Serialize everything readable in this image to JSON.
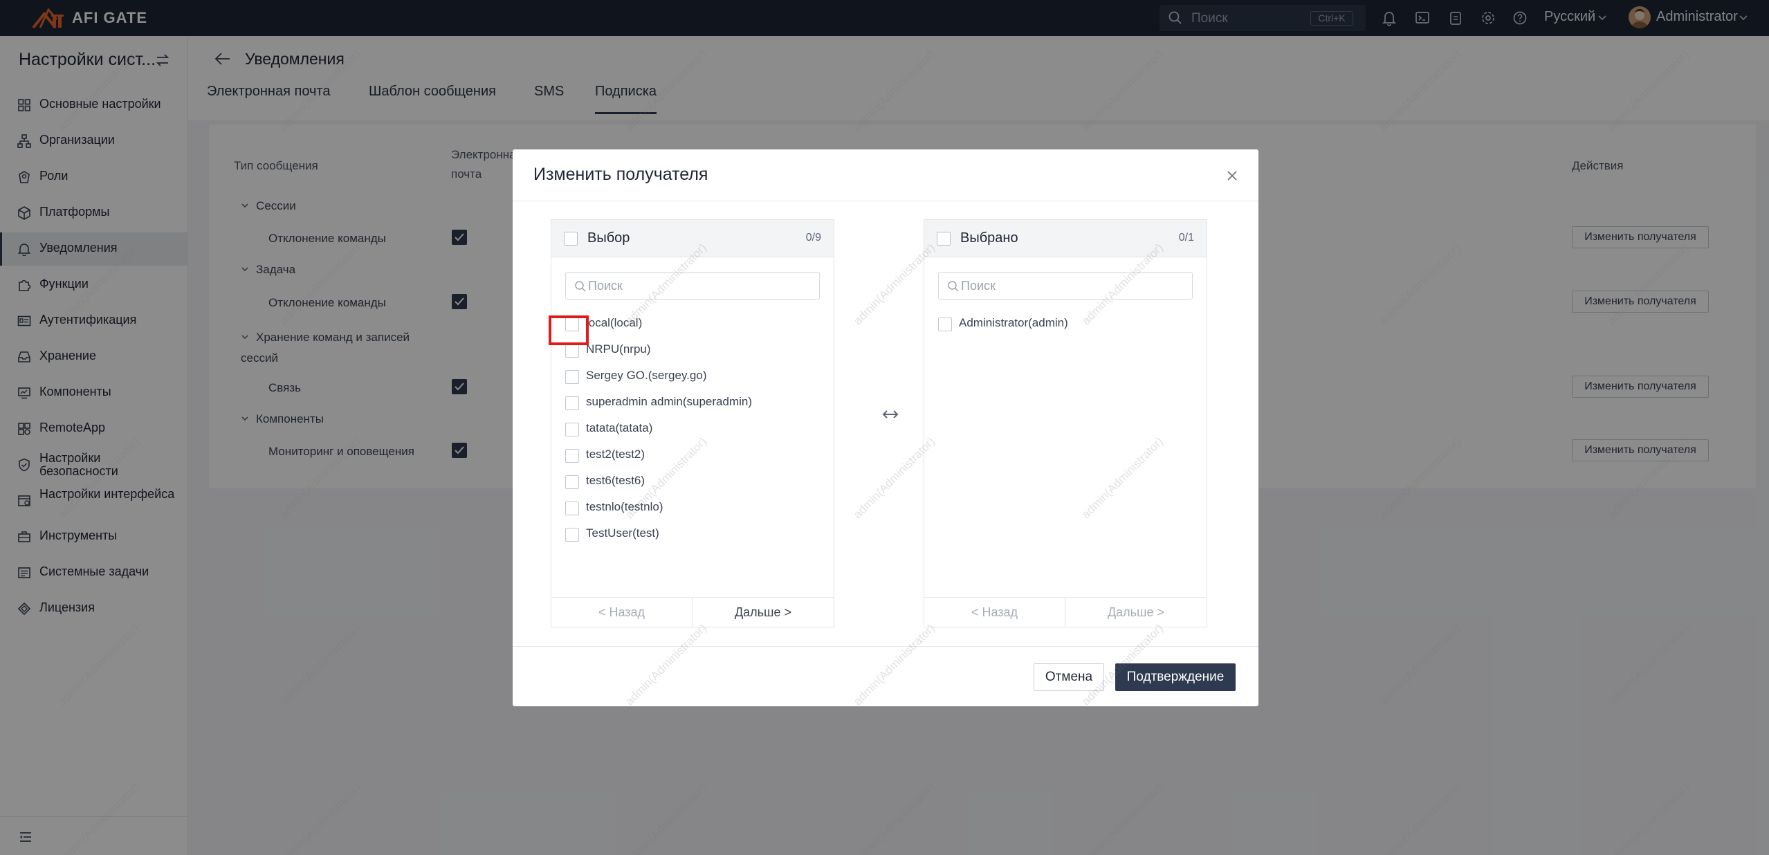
{
  "topbar": {
    "logo_text": "AFI GATE",
    "search_placeholder": "Поиск",
    "search_shortcut": "Ctrl+K",
    "language": "Русский",
    "user": "Administrator"
  },
  "sidebar": {
    "title": "Настройки сист...",
    "items": [
      {
        "label": "Основные настройки",
        "icon": "grid-icon"
      },
      {
        "label": "Организации",
        "icon": "org-tree-icon"
      },
      {
        "label": "Роли",
        "icon": "role-icon"
      },
      {
        "label": "Платформы",
        "icon": "cube-icon"
      },
      {
        "label": "Уведомления",
        "icon": "bell-icon"
      },
      {
        "label": "Функции",
        "icon": "puzzle-icon"
      },
      {
        "label": "Аутентификация",
        "icon": "id-card-icon"
      },
      {
        "label": "Хранение",
        "icon": "storage-icon"
      },
      {
        "label": "Компоненты",
        "icon": "monitor-icon"
      },
      {
        "label": "RemoteApp",
        "icon": "apps-icon"
      },
      {
        "label": "Настройки безопасности",
        "icon": "shield-icon"
      },
      {
        "label": "Настройки интерфейса",
        "icon": "interface-icon"
      },
      {
        "label": "Инструменты",
        "icon": "tools-icon"
      },
      {
        "label": "Системные задачи",
        "icon": "tasks-icon"
      },
      {
        "label": "Лицензия",
        "icon": "license-icon"
      }
    ],
    "active_index": 4
  },
  "page": {
    "title": "Уведомления",
    "tabs": [
      "Электронная почта",
      "Шаблон сообщения",
      "SMS",
      "Подписка"
    ],
    "active_tab": 3
  },
  "table": {
    "headers": {
      "type": "Тип сообщения",
      "email": "Электронная почта",
      "actions": "Действия"
    },
    "groups": [
      {
        "label": "Сессии",
        "items": [
          {
            "label": "Отклонение команды",
            "email_checked": true
          }
        ]
      },
      {
        "label": "Задача",
        "items": [
          {
            "label": "Отклонение команды",
            "email_checked": true
          }
        ]
      },
      {
        "label": "Хранение команд и записей сессий",
        "items": [
          {
            "label": "Связь",
            "email_checked": true
          }
        ]
      },
      {
        "label": "Компоненты",
        "items": [
          {
            "label": "Мониторинг и оповещения",
            "email_checked": true
          }
        ]
      }
    ],
    "action_label": "Изменить получателя"
  },
  "modal": {
    "title": "Изменить получателя",
    "left": {
      "title": "Выбор",
      "count": "0/9",
      "search_placeholder": "Поиск",
      "items": [
        "local(local)",
        "NRPU(nrpu)",
        "Sergey GO.(sergey.go)",
        "superadmin admin(superadmin)",
        "tatata(tatata)",
        "test2(test2)",
        "test6(test6)",
        "testnlo(testnlo)",
        "TestUser(test)"
      ],
      "prev": "< Назад",
      "next": "Дальше >"
    },
    "right": {
      "title": "Выбрано",
      "count": "0/1",
      "search_placeholder": "Поиск",
      "items": [
        "Administrator(admin)"
      ],
      "prev": "< Назад",
      "next": "Дальше >"
    },
    "cancel": "Отмена",
    "confirm": "Подтверждение"
  },
  "watermark": "admin(Administrator)",
  "colors": {
    "topbar": "#1c2536",
    "accent": "#2e3a4f",
    "highlight": "#e01b1b",
    "logo_accent": "#e8672b"
  }
}
